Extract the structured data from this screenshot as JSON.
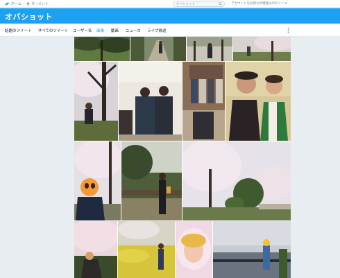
{
  "topnav": {
    "home_label": "ホーム",
    "moments_label": "モーメント",
    "search_value": "オバショット",
    "login_text": "アカウントをお持ちの場合はログイン ▾"
  },
  "header": {
    "title": "オバショット"
  },
  "tabs": [
    {
      "label": "話題のツイート",
      "active": false
    },
    {
      "label": "すべてのツイート",
      "active": false
    },
    {
      "label": "ユーザー名",
      "active": false
    },
    {
      "label": "画像",
      "active": true
    },
    {
      "label": "動画",
      "active": false
    },
    {
      "label": "ニュース",
      "active": false
    },
    {
      "label": "ライブ放送",
      "active": false
    }
  ],
  "colors": {
    "accent": "#1da1f2",
    "page_bg": "#e8edf1"
  }
}
